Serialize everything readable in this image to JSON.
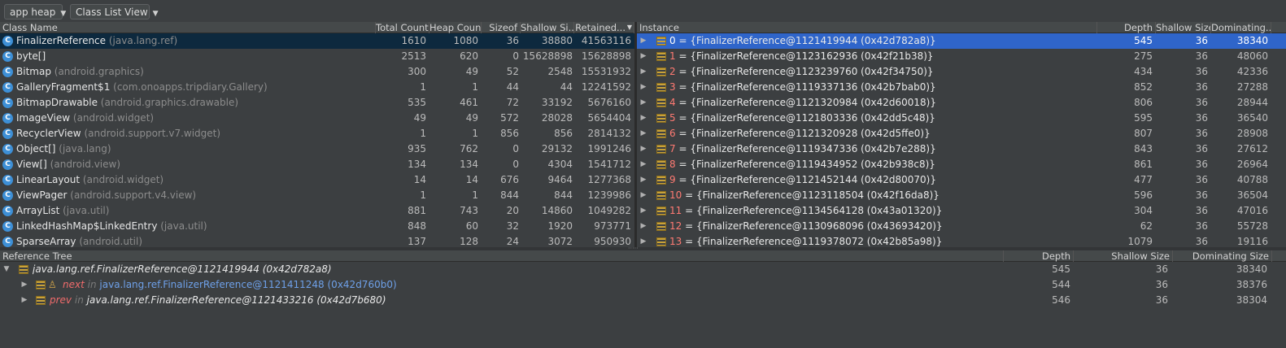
{
  "toolbar": {
    "heap_select": "app heap",
    "view_select": "Class List View"
  },
  "class_table": {
    "columns": [
      "Class Name",
      "Total Count",
      "Heap Count",
      "Sizeof",
      "Shallow Si...",
      "Retained..."
    ],
    "rows": [
      {
        "name": "FinalizerReference",
        "pkg": "(java.lang.ref)",
        "total": "1610",
        "heap": "1080",
        "sizeof": "36",
        "shallow": "38880",
        "retained": "41563116"
      },
      {
        "name": "byte[]",
        "pkg": "",
        "total": "2513",
        "heap": "620",
        "sizeof": "0",
        "shallow": "15628898",
        "retained": "15628898"
      },
      {
        "name": "Bitmap",
        "pkg": "(android.graphics)",
        "total": "300",
        "heap": "49",
        "sizeof": "52",
        "shallow": "2548",
        "retained": "15531932"
      },
      {
        "name": "GalleryFragment$1",
        "pkg": "(com.onoapps.tripdiary.Gallery)",
        "total": "1",
        "heap": "1",
        "sizeof": "44",
        "shallow": "44",
        "retained": "12241592"
      },
      {
        "name": "BitmapDrawable",
        "pkg": "(android.graphics.drawable)",
        "total": "535",
        "heap": "461",
        "sizeof": "72",
        "shallow": "33192",
        "retained": "5676160"
      },
      {
        "name": "ImageView",
        "pkg": "(android.widget)",
        "total": "49",
        "heap": "49",
        "sizeof": "572",
        "shallow": "28028",
        "retained": "5654404"
      },
      {
        "name": "RecyclerView",
        "pkg": "(android.support.v7.widget)",
        "total": "1",
        "heap": "1",
        "sizeof": "856",
        "shallow": "856",
        "retained": "2814132"
      },
      {
        "name": "Object[]",
        "pkg": "(java.lang)",
        "total": "935",
        "heap": "762",
        "sizeof": "0",
        "shallow": "29132",
        "retained": "1991246"
      },
      {
        "name": "View[]",
        "pkg": "(android.view)",
        "total": "134",
        "heap": "134",
        "sizeof": "0",
        "shallow": "4304",
        "retained": "1541712"
      },
      {
        "name": "LinearLayout",
        "pkg": "(android.widget)",
        "total": "14",
        "heap": "14",
        "sizeof": "676",
        "shallow": "9464",
        "retained": "1277368"
      },
      {
        "name": "ViewPager",
        "pkg": "(android.support.v4.view)",
        "total": "1",
        "heap": "1",
        "sizeof": "844",
        "shallow": "844",
        "retained": "1239986"
      },
      {
        "name": "ArrayList",
        "pkg": "(java.util)",
        "total": "881",
        "heap": "743",
        "sizeof": "20",
        "shallow": "14860",
        "retained": "1049282"
      },
      {
        "name": "LinkedHashMap$LinkedEntry",
        "pkg": "(java.util)",
        "total": "848",
        "heap": "60",
        "sizeof": "32",
        "shallow": "1920",
        "retained": "973771"
      },
      {
        "name": "SparseArray",
        "pkg": "(android.util)",
        "total": "137",
        "heap": "128",
        "sizeof": "24",
        "shallow": "3072",
        "retained": "950930"
      }
    ]
  },
  "instance_table": {
    "columns": [
      "Instance",
      "Depth",
      "Shallow Size",
      "Dominating..."
    ],
    "rows": [
      {
        "idx": "0",
        "ref": "= {FinalizerReference@1121419944 (0x42d782a8)}",
        "depth": "545",
        "shallow": "36",
        "dom": "38340"
      },
      {
        "idx": "1",
        "ref": "= {FinalizerReference@1123162936 (0x42f21b38)}",
        "depth": "275",
        "shallow": "36",
        "dom": "48060"
      },
      {
        "idx": "2",
        "ref": "= {FinalizerReference@1123239760 (0x42f34750)}",
        "depth": "434",
        "shallow": "36",
        "dom": "42336"
      },
      {
        "idx": "3",
        "ref": "= {FinalizerReference@1119337136 (0x42b7bab0)}",
        "depth": "852",
        "shallow": "36",
        "dom": "27288"
      },
      {
        "idx": "4",
        "ref": "= {FinalizerReference@1121320984 (0x42d60018)}",
        "depth": "806",
        "shallow": "36",
        "dom": "28944"
      },
      {
        "idx": "5",
        "ref": "= {FinalizerReference@1121803336 (0x42dd5c48)}",
        "depth": "595",
        "shallow": "36",
        "dom": "36540"
      },
      {
        "idx": "6",
        "ref": "= {FinalizerReference@1121320928 (0x42d5ffe0)}",
        "depth": "807",
        "shallow": "36",
        "dom": "28908"
      },
      {
        "idx": "7",
        "ref": "= {FinalizerReference@1119347336 (0x42b7e288)}",
        "depth": "843",
        "shallow": "36",
        "dom": "27612"
      },
      {
        "idx": "8",
        "ref": "= {FinalizerReference@1119434952 (0x42b938c8)}",
        "depth": "861",
        "shallow": "36",
        "dom": "26964"
      },
      {
        "idx": "9",
        "ref": "= {FinalizerReference@1121452144 (0x42d80070)}",
        "depth": "477",
        "shallow": "36",
        "dom": "40788"
      },
      {
        "idx": "10",
        "ref": "= {FinalizerReference@1123118504 (0x42f16da8)}",
        "depth": "596",
        "shallow": "36",
        "dom": "36504"
      },
      {
        "idx": "11",
        "ref": "= {FinalizerReference@1134564128 (0x43a01320)}",
        "depth": "304",
        "shallow": "36",
        "dom": "47016"
      },
      {
        "idx": "12",
        "ref": "= {FinalizerReference@1130968096 (0x43693420)}",
        "depth": "62",
        "shallow": "36",
        "dom": "55728"
      },
      {
        "idx": "13",
        "ref": "= {FinalizerReference@1119378072 (0x42b85a98)}",
        "depth": "1079",
        "shallow": "36",
        "dom": "19116"
      }
    ]
  },
  "reference_tree": {
    "columns": [
      "Reference Tree",
      "Depth",
      "Shallow Size",
      "Dominating Size"
    ],
    "root": {
      "text": "java.lang.ref.FinalizerReference@1121419944 (0x42d782a8)",
      "depth": "545",
      "shallow": "36",
      "dom": "38340"
    },
    "children": [
      {
        "field": "next",
        "in": "in",
        "target": "java.lang.ref.FinalizerReference@1121411248 (0x42d760b0)",
        "depth": "544",
        "shallow": "36",
        "dom": "38376"
      },
      {
        "field": "prev",
        "in": "in",
        "target": "java.lang.ref.FinalizerReference@1121433216 (0x42d7b680)",
        "depth": "546",
        "shallow": "36",
        "dom": "38304"
      }
    ]
  },
  "icons": {
    "class_icon_letter": "C"
  },
  "colors": {
    "selection_dark": "#0d293e",
    "selection_blue": "#2f65ca",
    "index_red": "#ff7a72",
    "link_blue": "#6ea0e8"
  }
}
